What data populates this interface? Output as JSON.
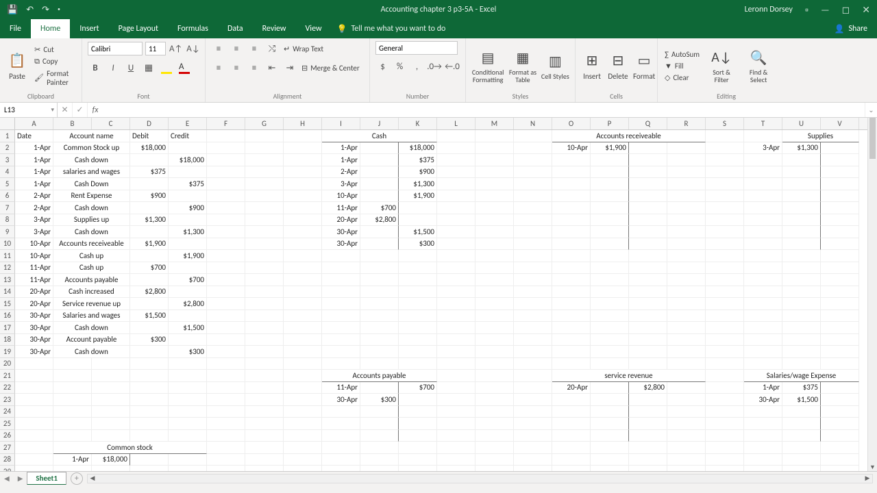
{
  "title": "Accounting chapter 3 p3-5A - Excel",
  "user": "Leronn Dorsey",
  "tabs": {
    "file": "File",
    "home": "Home",
    "insert": "Insert",
    "pagelayout": "Page Layout",
    "formulas": "Formulas",
    "data": "Data",
    "review": "Review",
    "view": "View",
    "tell": "Tell me what you want to do",
    "share": "Share"
  },
  "clipboard": {
    "paste": "Paste",
    "cut": "Cut",
    "copy": "Copy",
    "painter": "Format Painter",
    "label": "Clipboard"
  },
  "font": {
    "name": "Calibri",
    "size": "11",
    "label": "Font"
  },
  "alignment": {
    "wrap": "Wrap Text",
    "merge": "Merge & Center",
    "label": "Alignment"
  },
  "number": {
    "format": "General",
    "label": "Number"
  },
  "styles": {
    "cond": "Conditional Formatting",
    "table": "Format as Table",
    "cellst": "Cell Styles",
    "label": "Styles"
  },
  "cellsg": {
    "insert": "Insert",
    "delete": "Delete",
    "format": "Format",
    "label": "Cells"
  },
  "editing": {
    "autosum": "AutoSum",
    "fill": "Fill",
    "clear": "Clear",
    "sort": "Sort & Filter",
    "find": "Find & Select",
    "label": "Editing"
  },
  "namebox": "L13",
  "sheet": "Sheet1",
  "cols": [
    {
      "l": "A",
      "w": 56
    },
    {
      "l": "B",
      "w": 56
    },
    {
      "l": "C",
      "w": 56
    },
    {
      "l": "D",
      "w": 56
    },
    {
      "l": "E",
      "w": 56
    },
    {
      "l": "F",
      "w": 56
    },
    {
      "l": "G",
      "w": 56
    },
    {
      "l": "H",
      "w": 56
    },
    {
      "l": "I",
      "w": 56
    },
    {
      "l": "J",
      "w": 56
    },
    {
      "l": "K",
      "w": 56
    },
    {
      "l": "L",
      "w": 56
    },
    {
      "l": "M",
      "w": 56
    },
    {
      "l": "N",
      "w": 56
    },
    {
      "l": "O",
      "w": 56
    },
    {
      "l": "P",
      "w": 56
    },
    {
      "l": "Q",
      "w": 56
    },
    {
      "l": "R",
      "w": 56
    },
    {
      "l": "S",
      "w": 56
    },
    {
      "l": "T",
      "w": 56
    },
    {
      "l": "U",
      "w": 56
    },
    {
      "l": "V",
      "w": 56
    }
  ],
  "cells": {
    "A1": {
      "v": "Date"
    },
    "B1": {
      "v": "Account name",
      "span": 2,
      "a": "c"
    },
    "D1": {
      "v": "Debit"
    },
    "E1": {
      "v": "Credit"
    },
    "I1": {
      "v": "Cash",
      "span": 3,
      "a": "c",
      "bb": 1
    },
    "O1": {
      "v": "Accounts receiveable",
      "span": 4,
      "a": "c",
      "bb": 1
    },
    "U1": {
      "v": "Supplies",
      "span": 2,
      "a": "c",
      "bb": 1
    },
    "A2": {
      "v": "1-Apr",
      "a": "r"
    },
    "B2": {
      "v": "Common Stock up",
      "span": 2,
      "a": "c"
    },
    "D2": {
      "v": "$18,000",
      "a": "r"
    },
    "I2": {
      "v": "1-Apr",
      "a": "r"
    },
    "K2": {
      "v": "$18,000",
      "a": "r"
    },
    "O2": {
      "v": "10-Apr",
      "a": "r"
    },
    "P2": {
      "v": "$1,900",
      "a": "r"
    },
    "T2": {
      "v": "3-Apr",
      "a": "r"
    },
    "U2": {
      "v": "$1,300",
      "a": "r"
    },
    "A3": {
      "v": "1-Apr",
      "a": "r"
    },
    "B3": {
      "v": "Cash down",
      "span": 2,
      "a": "c"
    },
    "E3": {
      "v": "$18,000",
      "a": "r"
    },
    "I3": {
      "v": "1-Apr",
      "a": "r"
    },
    "K3": {
      "v": "$375",
      "a": "r"
    },
    "A4": {
      "v": "1-Apr",
      "a": "r"
    },
    "B4": {
      "v": "salaries and wages",
      "span": 2,
      "a": "c"
    },
    "D4": {
      "v": "$375",
      "a": "r"
    },
    "I4": {
      "v": "2-Apr",
      "a": "r"
    },
    "K4": {
      "v": "$900",
      "a": "r"
    },
    "A5": {
      "v": "1-Apr",
      "a": "r"
    },
    "B5": {
      "v": "Cash Down",
      "span": 2,
      "a": "c"
    },
    "E5": {
      "v": "$375",
      "a": "r"
    },
    "I5": {
      "v": "3-Apr",
      "a": "r"
    },
    "K5": {
      "v": "$1,300",
      "a": "r"
    },
    "A6": {
      "v": "2-Apr",
      "a": "r"
    },
    "B6": {
      "v": "Rent Expense",
      "span": 2,
      "a": "c"
    },
    "D6": {
      "v": "$900",
      "a": "r"
    },
    "I6": {
      "v": "10-Apr",
      "a": "r"
    },
    "K6": {
      "v": "$1,900",
      "a": "r"
    },
    "A7": {
      "v": "2-Apr",
      "a": "r"
    },
    "B7": {
      "v": "Cash down",
      "span": 2,
      "a": "c"
    },
    "E7": {
      "v": "$900",
      "a": "r"
    },
    "I7": {
      "v": "11-Apr",
      "a": "r"
    },
    "J7": {
      "v": "$700",
      "a": "r"
    },
    "A8": {
      "v": "3-Apr",
      "a": "r"
    },
    "B8": {
      "v": "Supplies up",
      "span": 2,
      "a": "c"
    },
    "D8": {
      "v": "$1,300",
      "a": "r"
    },
    "I8": {
      "v": "20-Apr",
      "a": "r"
    },
    "J8": {
      "v": "$2,800",
      "a": "r"
    },
    "A9": {
      "v": "3-Apr",
      "a": "r"
    },
    "B9": {
      "v": "Cash down",
      "span": 2,
      "a": "c"
    },
    "E9": {
      "v": "$1,300",
      "a": "r"
    },
    "I9": {
      "v": "30-Apr",
      "a": "r"
    },
    "K9": {
      "v": "$1,500",
      "a": "r"
    },
    "A10": {
      "v": "10-Apr",
      "a": "r"
    },
    "B10": {
      "v": "Accounts receiveable",
      "span": 2,
      "a": "c"
    },
    "D10": {
      "v": "$1,900",
      "a": "r"
    },
    "I10": {
      "v": "30-Apr",
      "a": "r"
    },
    "K10": {
      "v": "$300",
      "a": "r"
    },
    "A11": {
      "v": "10-Apr",
      "a": "r"
    },
    "B11": {
      "v": "Cash up",
      "span": 2,
      "a": "c"
    },
    "E11": {
      "v": "$1,900",
      "a": "r"
    },
    "A12": {
      "v": "11-Apr",
      "a": "r"
    },
    "B12": {
      "v": "Cash up",
      "span": 2,
      "a": "c"
    },
    "D12": {
      "v": "$700",
      "a": "r"
    },
    "A13": {
      "v": "11-Apr",
      "a": "r"
    },
    "B13": {
      "v": "Accounts payable",
      "span": 2,
      "a": "c"
    },
    "E13": {
      "v": "$700",
      "a": "r"
    },
    "A14": {
      "v": "20-Apr",
      "a": "r"
    },
    "B14": {
      "v": "Cash increased",
      "span": 2,
      "a": "c"
    },
    "D14": {
      "v": "$2,800",
      "a": "r"
    },
    "A15": {
      "v": "20-Apr",
      "a": "r"
    },
    "B15": {
      "v": "Service revenue up",
      "span": 2,
      "a": "c"
    },
    "E15": {
      "v": "$2,800",
      "a": "r"
    },
    "A16": {
      "v": "30-Apr",
      "a": "r"
    },
    "B16": {
      "v": "Salaries and wages",
      "span": 2,
      "a": "c"
    },
    "D16": {
      "v": "$1,500",
      "a": "r"
    },
    "A17": {
      "v": "30-Apr",
      "a": "r"
    },
    "B17": {
      "v": "Cash down",
      "span": 2,
      "a": "c"
    },
    "E17": {
      "v": "$1,500",
      "a": "r"
    },
    "A18": {
      "v": "30-Apr",
      "a": "r"
    },
    "B18": {
      "v": "Account payable",
      "span": 2,
      "a": "c"
    },
    "D18": {
      "v": "$300",
      "a": "r"
    },
    "A19": {
      "v": "30-Apr",
      "a": "r"
    },
    "B19": {
      "v": "Cash down",
      "span": 2,
      "a": "c"
    },
    "E19": {
      "v": "$300",
      "a": "r"
    },
    "I21": {
      "v": "Accounts payable",
      "span": 3,
      "a": "c",
      "bb": 1
    },
    "O21": {
      "v": "service revenue",
      "span": 4,
      "a": "c",
      "bb": 1
    },
    "T21": {
      "v": "Salaries/wage Expense",
      "span": 3,
      "a": "c",
      "bb": 1
    },
    "I22": {
      "v": "11-Apr",
      "a": "r"
    },
    "K22": {
      "v": "$700",
      "a": "r"
    },
    "O22": {
      "v": "20-Apr",
      "a": "r"
    },
    "Q22": {
      "v": "$2,800",
      "a": "r"
    },
    "T22": {
      "v": "1-Apr",
      "a": "r"
    },
    "U22": {
      "v": "$375",
      "a": "r"
    },
    "I23": {
      "v": "30-Apr",
      "a": "r"
    },
    "J23": {
      "v": "$300",
      "a": "r"
    },
    "T23": {
      "v": "30-Apr",
      "a": "r"
    },
    "U23": {
      "v": "$1,500",
      "a": "r"
    },
    "B27": {
      "v": "Common stock",
      "span": 4,
      "a": "c",
      "bb": 1
    },
    "B28": {
      "v": "1-Apr",
      "a": "r"
    },
    "C28": {
      "v": "$18,000",
      "a": "r"
    }
  },
  "taccount_dividers": {
    "J": [
      2,
      3,
      4,
      5,
      6,
      7,
      8,
      9,
      10
    ],
    "P": [
      2,
      3,
      4,
      5,
      6,
      7,
      8,
      9,
      10,
      22,
      23,
      24,
      25,
      26
    ],
    "U": [
      2,
      3,
      4,
      5,
      6,
      7,
      8,
      9,
      10,
      22,
      23,
      24,
      25,
      26
    ],
    "J2": [
      22,
      23,
      24,
      25,
      26
    ],
    "C": [
      28
    ]
  },
  "rowcount": 29
}
